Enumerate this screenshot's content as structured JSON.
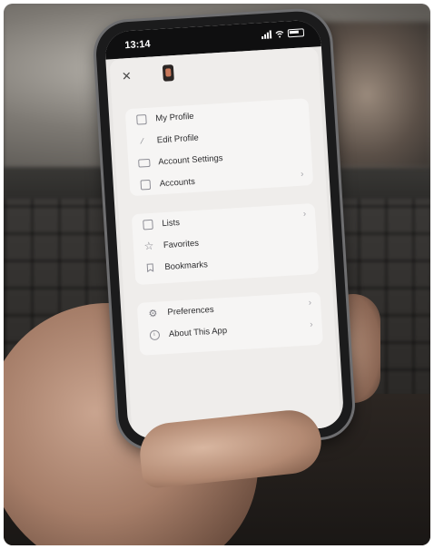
{
  "status_bar": {
    "time": "13:14"
  },
  "menu": {
    "groups": [
      {
        "items": [
          {
            "label": "My Profile",
            "icon": "id-card-icon",
            "chevron": false
          },
          {
            "label": "Edit Profile",
            "icon": "pencil-icon",
            "chevron": false
          },
          {
            "label": "Account Settings",
            "icon": "settings-card-icon",
            "chevron": false
          },
          {
            "label": "Accounts",
            "icon": "building-icon",
            "chevron": true
          }
        ]
      },
      {
        "items": [
          {
            "label": "Lists",
            "icon": "list-icon",
            "chevron": true
          },
          {
            "label": "Favorites",
            "icon": "star-icon",
            "chevron": false
          },
          {
            "label": "Bookmarks",
            "icon": "bookmark-icon",
            "chevron": false
          }
        ]
      },
      {
        "items": [
          {
            "label": "Preferences",
            "icon": "gear-icon",
            "chevron": true
          },
          {
            "label": "About This App",
            "icon": "info-icon",
            "chevron": true
          }
        ]
      }
    ]
  },
  "glyphs": {
    "close": "✕",
    "chevron": "›",
    "pencil": "⁄",
    "star": "☆",
    "info": "i",
    "gear": "⚙"
  }
}
